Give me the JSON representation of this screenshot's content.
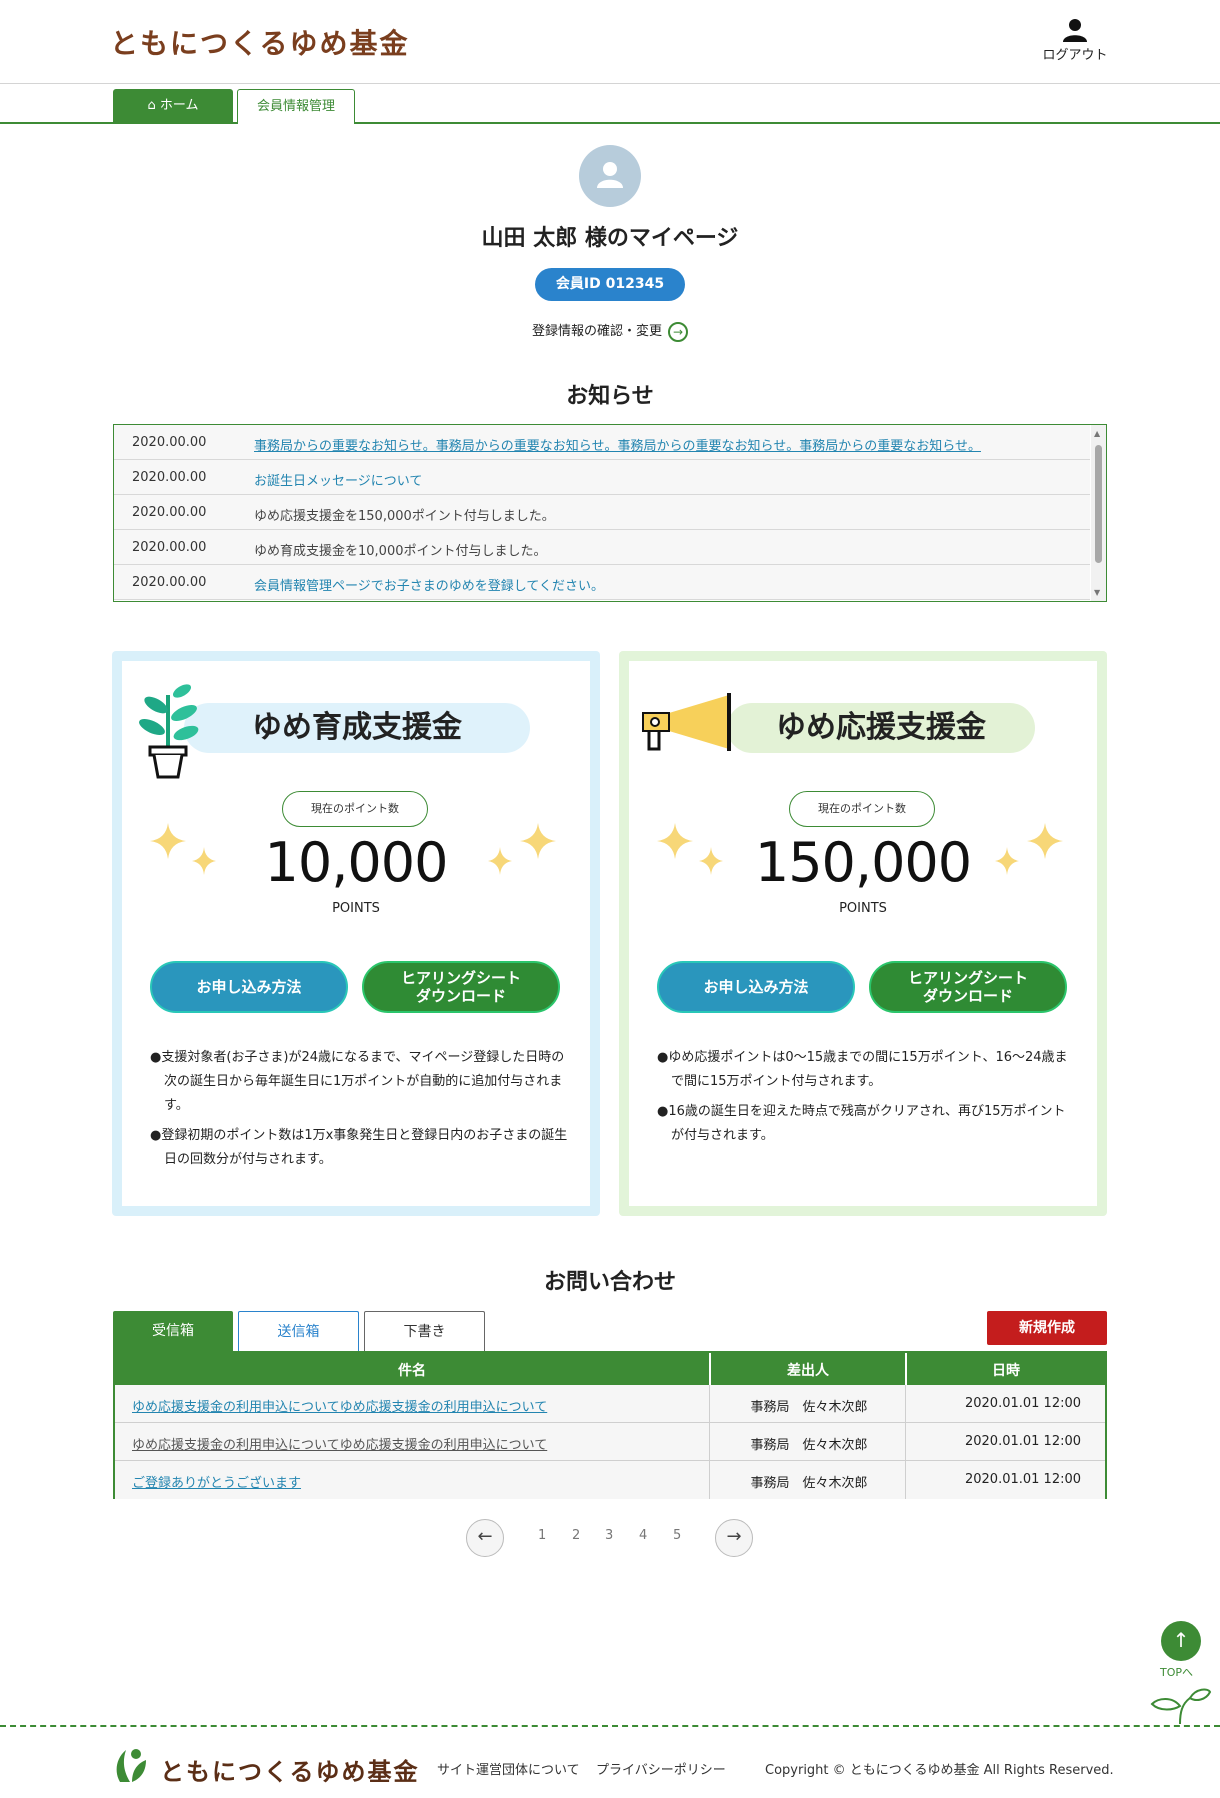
{
  "header": {
    "logo": "ともにつくるゆめ基金",
    "logout_label": "ログアウト"
  },
  "nav": {
    "home": "ホーム",
    "member": "会員情報管理"
  },
  "profile": {
    "title": "山田 太郎 様のマイページ",
    "member_id": "会員ID 012345",
    "edit_link": "登録情報の確認・変更"
  },
  "notices": {
    "title": "お知らせ",
    "items": [
      {
        "date": "2020.00.00",
        "text": "事務局からの重要なお知らせ。事務局からの重要なお知らせ。事務局からの重要なお知らせ。事務局からの重要なお知らせ。"
      },
      {
        "date": "2020.00.00",
        "text": "お誕生日メッセージについて"
      },
      {
        "date": "2020.00.00",
        "text": "ゆめ応援支援金を150,000ポイント付与しました。"
      },
      {
        "date": "2020.00.00",
        "text": "ゆめ育成支援金を10,000ポイント付与しました。"
      },
      {
        "date": "2020.00.00",
        "text": "会員情報管理ページでお子さまのゆめを登録してください。"
      }
    ]
  },
  "funds": [
    {
      "title": "ゆめ育成支援金",
      "points_label": "現在のポイント数",
      "points": "10,000",
      "unit": "POINTS",
      "apply_label": "お申し込み方法",
      "download_label_1": "ヒアリングシート",
      "download_label_2": "ダウンロード",
      "desc": [
        "●支援対象者(お子さま)が24歳になるまで、マイページ登録した日時の次の誕生日から毎年誕生日に1万ポイントが自動的に追加付与されます。",
        "●登録初期のポイント数は1万x事象発生日と登録日内のお子さまの誕生日の回数分が付与されます。"
      ]
    },
    {
      "title": "ゆめ応援支援金",
      "points_label": "現在のポイント数",
      "points": "150,000",
      "unit": "POINTS",
      "apply_label": "お申し込み方法",
      "download_label_1": "ヒアリングシート",
      "download_label_2": "ダウンロード",
      "desc": [
        "●ゆめ応援ポイントは0〜15歳までの間に15万ポイント、16〜24歳まで間に15万ポイント付与されます。",
        "●16歳の誕生日を迎えた時点で残高がクリアされ、再び15万ポイントが付与されます。"
      ]
    }
  ],
  "inquiry": {
    "title": "お問い合わせ",
    "tabs": [
      "受信箱",
      "送信箱",
      "下書き"
    ],
    "new_button": "新規作成",
    "columns": [
      "件名",
      "差出人",
      "日時"
    ],
    "rows": [
      {
        "subject": "ゆめ応援支援金の利用申込についてゆめ応援支援金の利用申込について",
        "sender": "事務局　佐々木次郎",
        "date": "2020.01.01 12:00"
      },
      {
        "subject": "ゆめ応援支援金の利用申込についてゆめ応援支援金の利用申込について",
        "sender": "事務局　佐々木次郎",
        "date": "2020.01.01 12:00"
      },
      {
        "subject": "ご登録ありがとうございます",
        "sender": "事務局　佐々木次郎",
        "date": "2020.01.01 12:00"
      }
    ],
    "pages": [
      "1",
      "2",
      "3",
      "4",
      "5"
    ]
  },
  "top_label": "TOPへ",
  "footer": {
    "logo": "ともにつくるゆめ基金",
    "link_about": "サイト運営団体について",
    "link_privacy": "プライバシーポリシー",
    "copyright": "Copyright © ともにつくるゆめ基金 All Rights Reserved."
  },
  "colors": {
    "brand_green": "#3d8b35",
    "brand_brown": "#7a3e1e",
    "link_blue": "#2385b0",
    "id_blue": "#2a83cc",
    "alert_red": "#c41d1d"
  }
}
